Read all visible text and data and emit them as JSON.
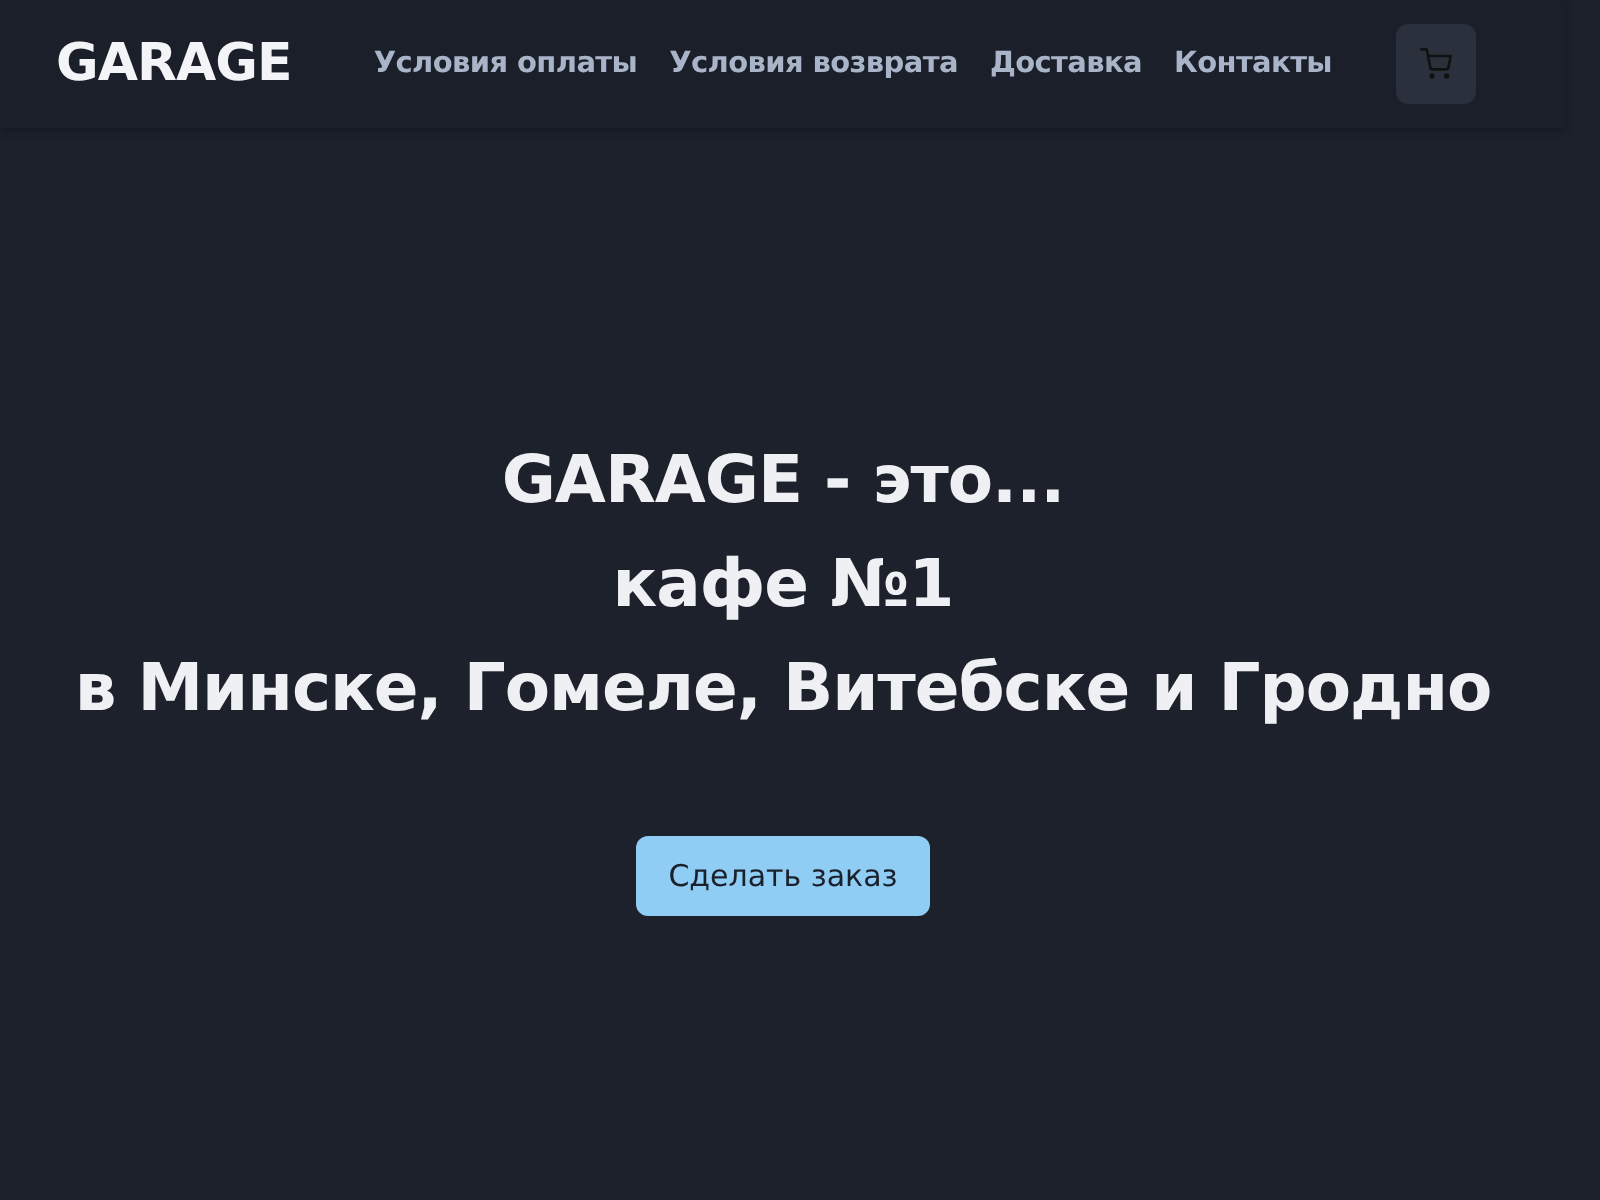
{
  "header": {
    "logo": "GARAGE",
    "nav": [
      "Условия оплаты",
      "Условия возврата",
      "Доставка",
      "Контакты"
    ]
  },
  "hero": {
    "lines": [
      "GARAGE - это...",
      "кафе №1",
      "в Минске, Гомеле, Витебске и Гродно"
    ],
    "button": "Сделать заказ"
  }
}
